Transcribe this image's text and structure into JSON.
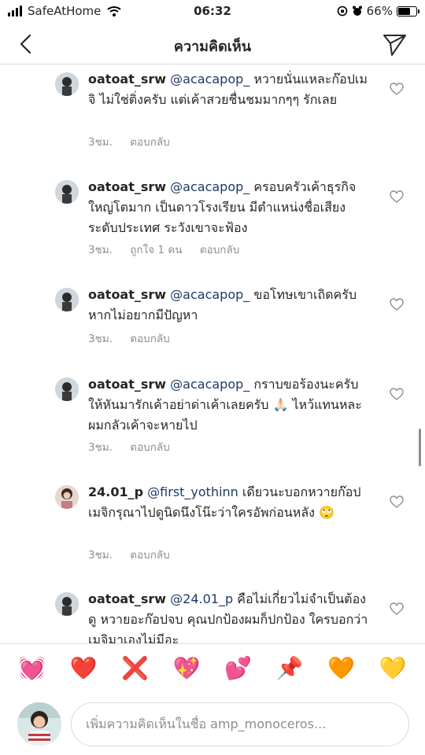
{
  "status_bar": {
    "carrier": "SafeAtHome",
    "time": "06:32",
    "battery": "66%",
    "battery_level": 0.66
  },
  "header": {
    "title": "ความคิดเห็น",
    "back_icon": "chevron-left-icon",
    "send_icon": "paper-plane-icon"
  },
  "comments": [
    {
      "username": "oatoat_srw",
      "mention": "@acacapop_",
      "text": "หวายนั่นแหละก๊อปเมจิ ไม่ใช่ติ่งครับ แต่เค้าสวยชื่นชมมากๆๆ รักเลย",
      "time": "3ชม.",
      "likes": "",
      "reply": "ตอบกลับ"
    },
    {
      "username": "oatoat_srw",
      "mention": "@acacapop_",
      "text": "ครอบครัวเค้าธุรกิจใหญ่โตมาก เป็นดาวโรงเรียน มีตำแหน่งชื่อเสียงระดับประเทศ ระวังเขาจะฟ้อง",
      "time": "3ชม.",
      "likes": "ถูกใจ 1 คน",
      "reply": "ตอบกลับ"
    },
    {
      "username": "oatoat_srw",
      "mention": "@acacapop_",
      "text": "ขอโทษเขาเถิดครับ หากไม่อยากมีปัญหา",
      "time": "3ชม.",
      "likes": "",
      "reply": "ตอบกลับ"
    },
    {
      "username": "oatoat_srw",
      "mention": "@acacapop_",
      "text": "กราบขอร้องนะครับ ให้หันมารักเค้าอย่าด่าเค้าเลยครับ 🙏🏻 ไหว้แทนหละ ผมกลัวเค้าจะหายไป",
      "time": "3ชม.",
      "likes": "",
      "reply": "ตอบกลับ"
    },
    {
      "username": "24.01_p",
      "mention": "@first_yothinn",
      "text": "เดียวนะบอกหวายก๊อปเมจิกรุณาไปดูนิดนึงโน๊ะว่าใครอัพก่อนหลัง 🙄",
      "time": "3ชม.",
      "likes": "",
      "reply": "ตอบกลับ"
    },
    {
      "username": "oatoat_srw",
      "mention": "@24.01_p",
      "text": "คือไม่เกี่ยวไม่จำเป็นต้องดู หวายอะก๊อปจบ คุณปกป้องผมก็ปกป้อง ใครบอกว่าเมจิมาเองไม่มีอะ",
      "time": "",
      "likes": "",
      "reply": ""
    }
  ],
  "emoji_bar": [
    "💓",
    "❤️",
    "❌",
    "💖",
    "💕",
    "📌",
    "🧡",
    "💛"
  ],
  "input": {
    "placeholder": "เพิ่มความคิดเห็นในชื่อ amp_monoceros..."
  }
}
